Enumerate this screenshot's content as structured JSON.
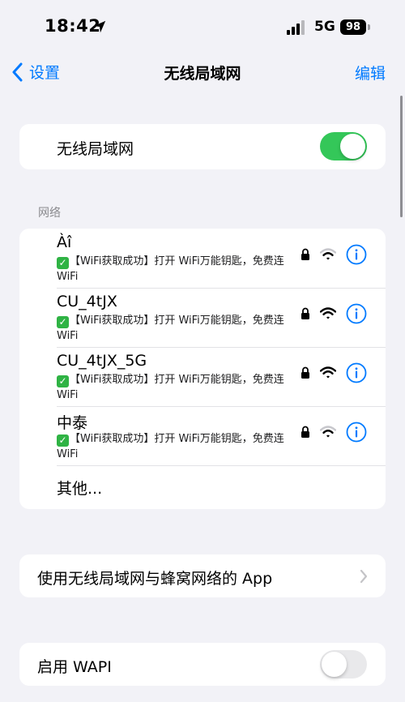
{
  "status_bar": {
    "time": "18:42",
    "network": "5G",
    "battery": "98",
    "icons": [
      "location-arrow-icon",
      "cellular-signal-icon",
      "battery-icon"
    ]
  },
  "nav": {
    "back_label": "设置",
    "title": "无线局域网",
    "edit_label": "编辑",
    "icons": [
      "chevron-left-icon"
    ]
  },
  "wifi_toggle": {
    "label": "无线局域网",
    "on": true
  },
  "networks_section": {
    "header": "网络",
    "items": [
      {
        "ssid": "Àî",
        "description": "【WiFi获取成功】打开 WiFi万能钥匙，免费连 WiFi",
        "locked": true,
        "signal": "weak"
      },
      {
        "ssid": "CU_4tJX",
        "description": "【WiFi获取成功】打开 WiFi万能钥匙，免费连 WiFi",
        "locked": true,
        "signal": "strong"
      },
      {
        "ssid": "CU_4tJX_5G",
        "description": "【WiFi获取成功】打开 WiFi万能钥匙，免费连 WiFi",
        "locked": true,
        "signal": "strong"
      },
      {
        "ssid": "中泰",
        "description": "【WiFi获取成功】打开 WiFi万能钥匙，免费连 WiFi",
        "locked": true,
        "signal": "weak"
      }
    ],
    "other_label": "其他...",
    "icons": [
      "check-icon",
      "lock-icon",
      "wifi-signal-icon",
      "info-icon"
    ]
  },
  "apps_row": {
    "label": "使用无线局域网与蜂窝网络的 App",
    "icons": [
      "chevron-right-icon"
    ]
  },
  "wapi": {
    "label": "启用 WAPI",
    "on": false
  },
  "colors": {
    "accent": "#007aff",
    "toggle_on": "#34c759",
    "toggle_off": "#e9e9eb",
    "background": "#f2f2f7"
  }
}
